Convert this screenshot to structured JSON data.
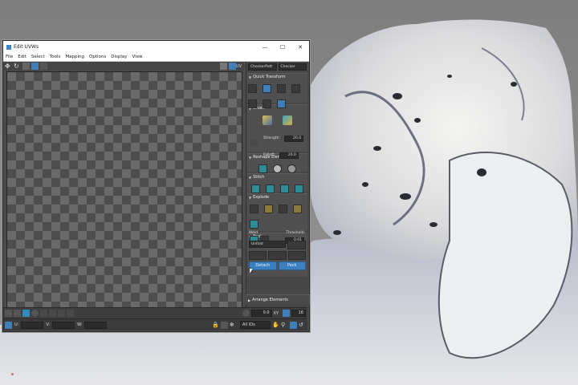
{
  "window": {
    "title": "Edit UVWs",
    "controls": {
      "minimize": "—",
      "maximize": "☐",
      "close": "✕"
    }
  },
  "menu": [
    "File",
    "Edit",
    "Select",
    "Tools",
    "Mapping",
    "Options",
    "Display",
    "View"
  ],
  "toolbar": {
    "uv_label": "UV"
  },
  "panel": {
    "dropdown_left": "CheckerPatt",
    "dropdown_right": "Checker",
    "sections": {
      "quick_transform": "Quick Transform",
      "brush": "Brush",
      "reshape": "Reshape Elements",
      "stitch": "Stitch",
      "explode": "Explode",
      "peel": "Peel",
      "arrange": "Arrange Elements"
    },
    "brush": {
      "strength_label": "Strength:",
      "strength_value": "20.0",
      "falloff_label": "Falloff:",
      "falloff_value": "20.0"
    },
    "explode": {
      "weld_label": "Weld",
      "threshold_label": "Threshold:",
      "threshold_value": "0.01"
    },
    "peel": {
      "mode": "Unfold",
      "detach_label": "Detach",
      "pack_label": "Pack"
    }
  },
  "bottom": {
    "zoom_value": "0.0",
    "xy_label": "XY",
    "grid_value": "16",
    "u_label": "U:",
    "v_label": "V:",
    "w_label": "W:",
    "id_filter": "All IDs"
  },
  "colors": {
    "accent_blue": "#3b7fc1",
    "checker_dark": "#4e4e4e",
    "checker_light": "#6a6a6a"
  }
}
